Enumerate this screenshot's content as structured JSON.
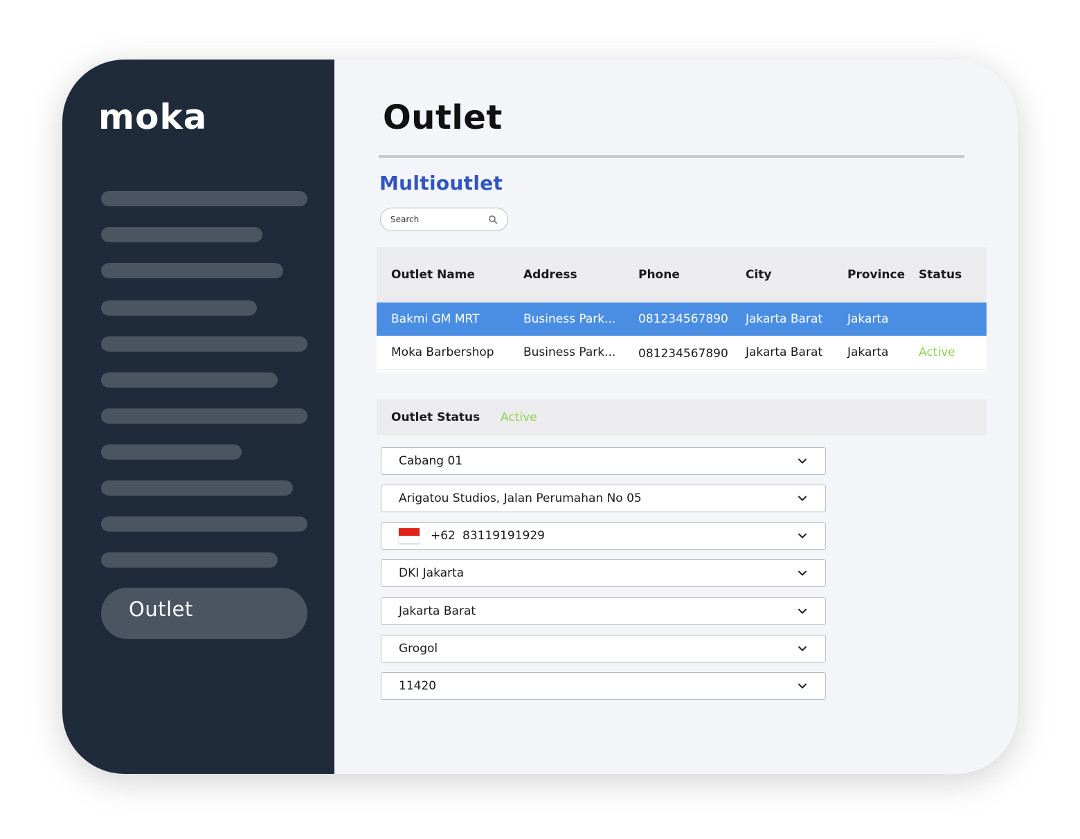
{
  "sidebar": {
    "logo": "moka",
    "active_item": "Outlet"
  },
  "main": {
    "title": "Outlet",
    "section_title": "Multioutlet",
    "search": {
      "placeholder": "Search",
      "value": ""
    },
    "table": {
      "headers": [
        "Outlet Name",
        "Address",
        "Phone",
        "City",
        "Province",
        "Status"
      ],
      "rows": [
        {
          "outlet_name": "Bakmi GM MRT",
          "address": "Business Park...",
          "phone": "081234567890",
          "city": "Jakarta Barat",
          "province": "Jakarta",
          "status": "",
          "selected": true
        },
        {
          "outlet_name": "Moka Barbershop",
          "address": "Business Park...",
          "phone": "081234567890",
          "city": "Jakarta Barat",
          "province": "Jakarta",
          "status": "Active",
          "selected": false
        }
      ]
    },
    "outlet_status": {
      "label": "Outlet Status",
      "value": "Active"
    },
    "form": {
      "outlet": "Cabang 01",
      "address": "Arigatou Studios, Jalan Perumahan No 05",
      "phone": {
        "flag": "flag-icon-indonesia",
        "dial_code": "+62",
        "number": "83119191929"
      },
      "province": "DKI Jakarta",
      "city": "Jakarta Barat",
      "district": "Grogol",
      "postal_code": "11420"
    }
  },
  "colors": {
    "sidebar_bg": "#1f2b3b",
    "accent_blue": "#2f55c0",
    "selected_row": "#4a8ee3",
    "active_green": "#8fd14f"
  }
}
